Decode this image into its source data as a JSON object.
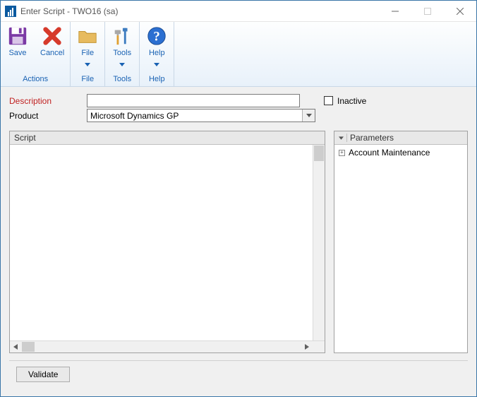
{
  "window": {
    "title": "Enter Script  -  TWO16 (sa)"
  },
  "ribbon": {
    "groups": [
      {
        "label": "Actions",
        "buttons": [
          {
            "key": "save",
            "label": "Save",
            "has_dropdown": false
          },
          {
            "key": "cancel",
            "label": "Cancel",
            "has_dropdown": false
          }
        ]
      },
      {
        "label": "File",
        "buttons": [
          {
            "key": "file",
            "label": "File",
            "has_dropdown": true
          }
        ]
      },
      {
        "label": "Tools",
        "buttons": [
          {
            "key": "tools",
            "label": "Tools",
            "has_dropdown": true
          }
        ]
      },
      {
        "label": "Help",
        "buttons": [
          {
            "key": "help",
            "label": "Help",
            "has_dropdown": true
          }
        ]
      }
    ]
  },
  "form": {
    "description_label": "Description",
    "description_value": "",
    "product_label": "Product",
    "product_value": "Microsoft Dynamics GP",
    "inactive_label": "Inactive",
    "inactive_checked": false
  },
  "script_panel": {
    "header": "Script",
    "content": ""
  },
  "params_panel": {
    "header": "Parameters",
    "items": [
      {
        "label": "Account Maintenance",
        "expandable": true
      }
    ]
  },
  "footer": {
    "validate_label": "Validate"
  }
}
